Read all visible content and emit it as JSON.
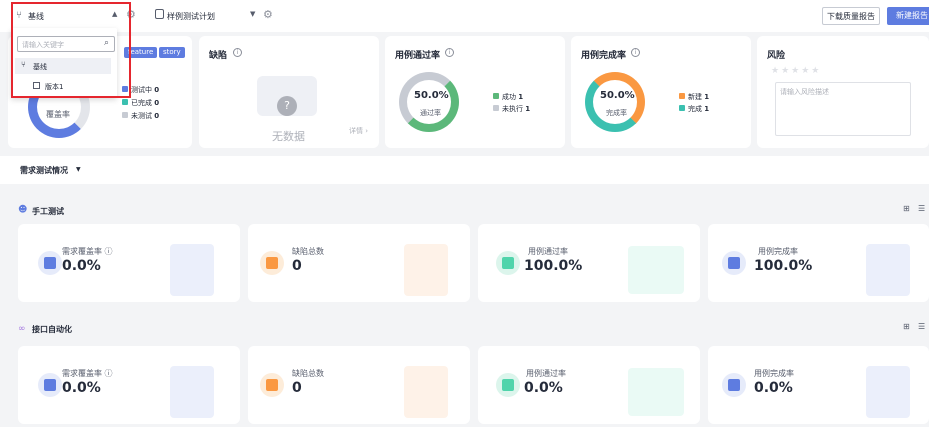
{
  "topbar": {
    "baseline_select": "基线",
    "plan_select": "样例测试计划",
    "download_report": "下载质量报告",
    "new_report": "新建报告"
  },
  "dropdown": {
    "search_placeholder": "请输入关键字",
    "items": [
      "基线",
      "版本1"
    ]
  },
  "summary": {
    "tags": [
      "feature",
      "story"
    ],
    "rate_label": "覆盖率",
    "legend": [
      {
        "label": "测试中",
        "value": "0"
      },
      {
        "label": "已完成",
        "value": "0"
      },
      {
        "label": "未测试",
        "value": "0"
      }
    ]
  },
  "defects": {
    "title": "缺陷",
    "empty": "无数据",
    "detail": "详情"
  },
  "pass_rate": {
    "title": "用例通过率",
    "value": "50.0%",
    "sub": "通过率",
    "legend": [
      {
        "label": "成功",
        "value": "1",
        "color": "#5cb87a"
      },
      {
        "label": "未执行",
        "value": "1",
        "color": "#c7cbd3"
      }
    ]
  },
  "complete_rate": {
    "title": "用例完成率",
    "value": "50.0%",
    "sub": "完成率",
    "legend": [
      {
        "label": "新建",
        "value": "1",
        "color": "#fa9841"
      },
      {
        "label": "完成",
        "value": "1",
        "color": "#3bc0b0"
      }
    ]
  },
  "risk": {
    "title": "风险",
    "placeholder": "请输入风险描述"
  },
  "section": {
    "title": "需求测试情况"
  },
  "manual": {
    "title": "手工测试",
    "metrics": [
      {
        "label": "需求覆盖率",
        "value": "0.0%",
        "color": "#5e7ce0"
      },
      {
        "label": "缺陷总数",
        "value": "0",
        "color": "#fa9841"
      },
      {
        "label": "用例通过率",
        "value": "100.0%",
        "color": "#50d4ab"
      },
      {
        "label": "用例完成率",
        "value": "100.0%",
        "color": "#5e7ce0"
      }
    ]
  },
  "api": {
    "title": "接口自动化",
    "metrics": [
      {
        "label": "需求覆盖率",
        "value": "0.0%",
        "color": "#5e7ce0"
      },
      {
        "label": "缺陷总数",
        "value": "0",
        "color": "#fa9841"
      },
      {
        "label": "用例通过率",
        "value": "0.0%",
        "color": "#50d4ab"
      },
      {
        "label": "用例完成率",
        "value": "0.0%",
        "color": "#5e7ce0"
      }
    ]
  }
}
